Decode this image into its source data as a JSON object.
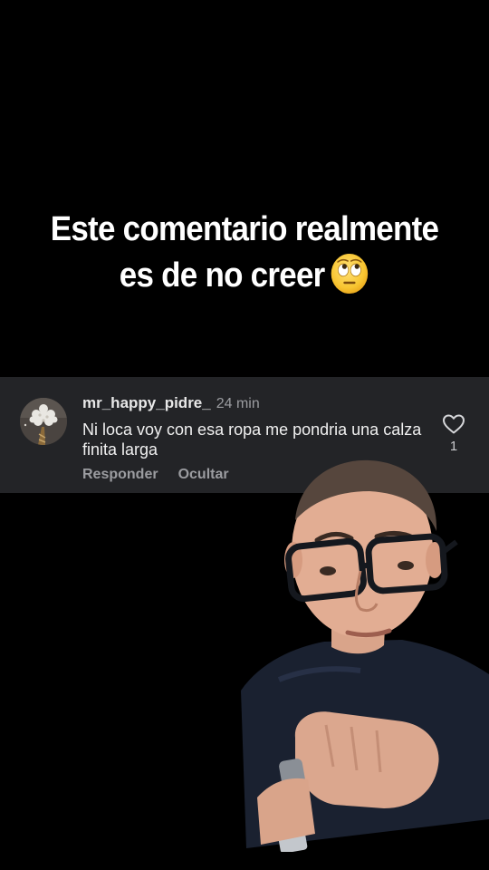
{
  "caption": {
    "line1": "Este comentario realmente",
    "line2": "es de no creer",
    "emoji": "face-with-rolling-eyes-icon"
  },
  "comment": {
    "username": "mr_happy_pidre_",
    "time": "24 min",
    "text": "Ni loca voy con esa ropa me pondria una calza finita larga",
    "reply_label": "Responder",
    "hide_label": "Ocultar",
    "like_count": "1",
    "like_icon": "heart-outline-icon",
    "avatar_icon": "avatar-flower-icon"
  },
  "colors": {
    "background": "#000000",
    "card": "#232427",
    "username": "#e8e8e8",
    "muted": "#9b9ca0",
    "text": "#f0f0f0"
  }
}
